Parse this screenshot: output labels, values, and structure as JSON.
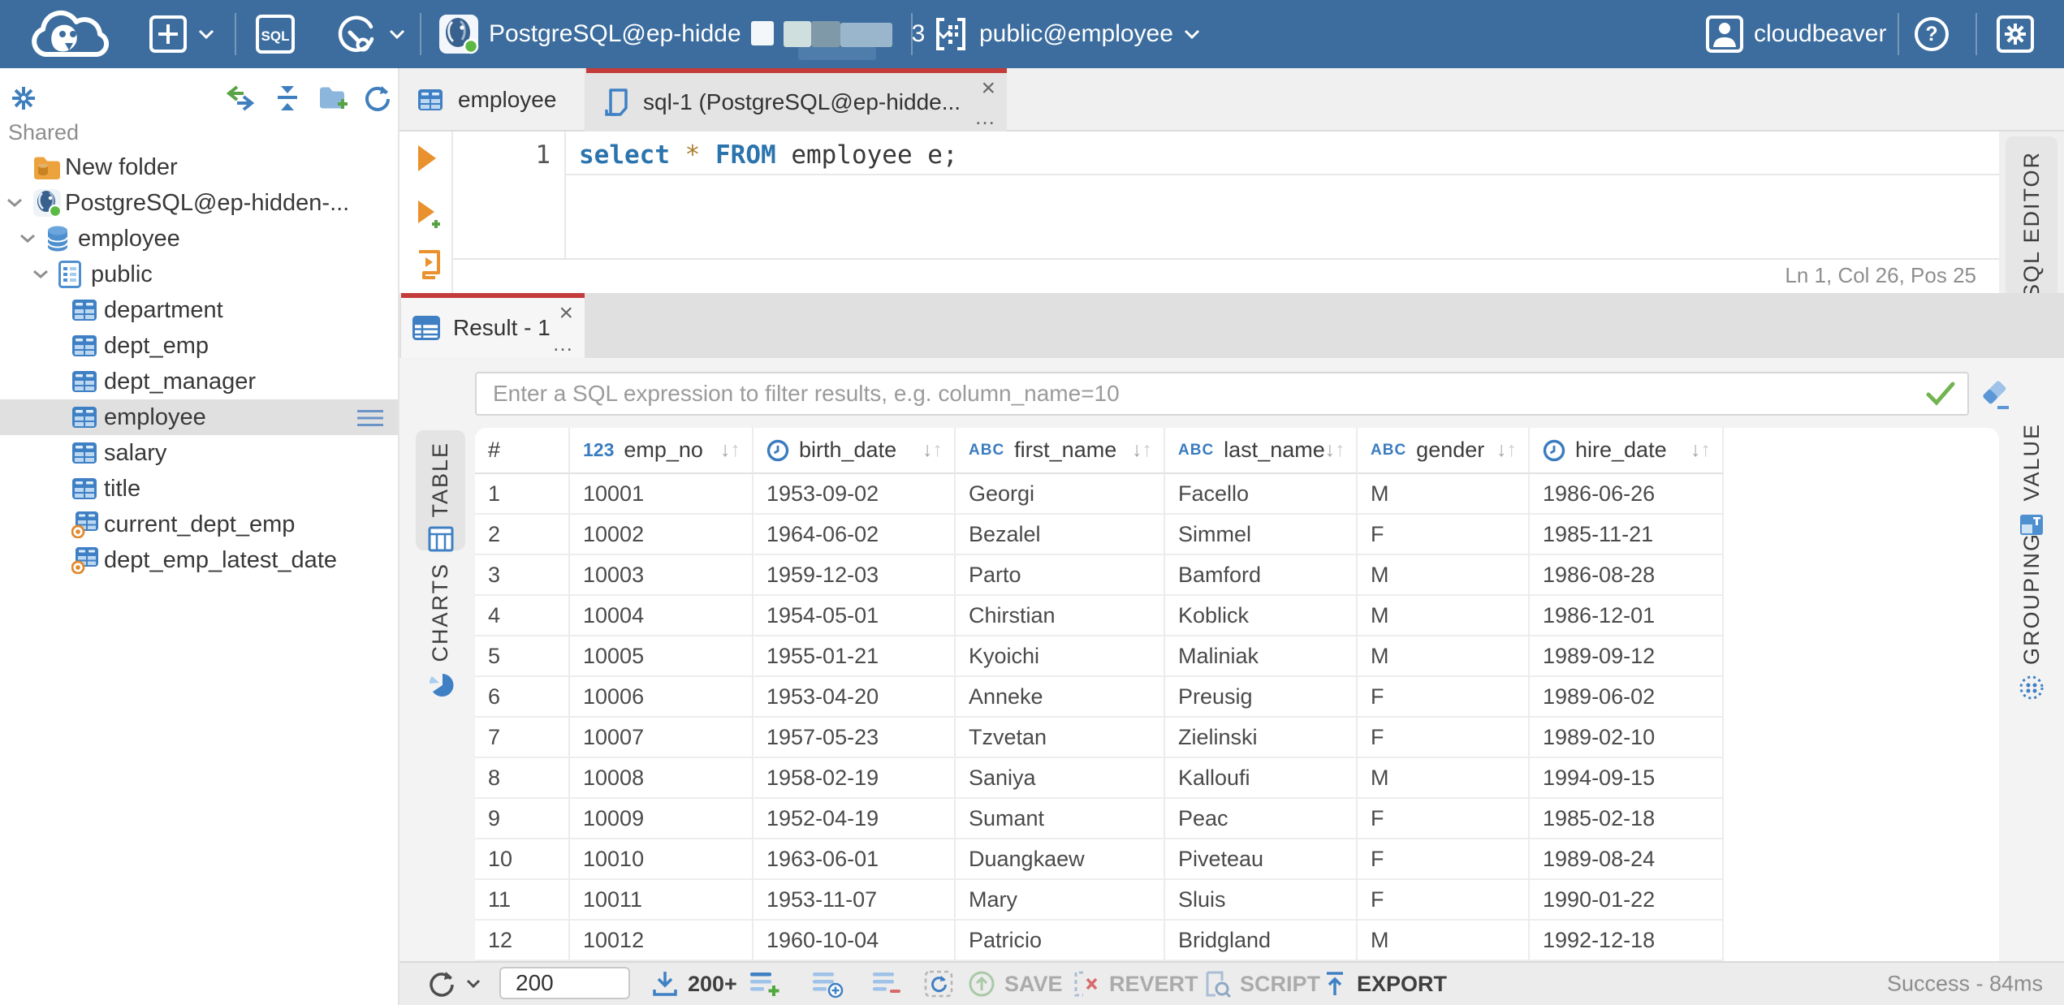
{
  "colors": {
    "topbar_blue": "#3c6d9e",
    "accent_red": "#c43b3b",
    "accent_blue": "#3f80c4",
    "success_green": "#72b352",
    "icon_orange": "#e8912d"
  },
  "topbar": {
    "buttons": {
      "sql_badge": "SQL"
    },
    "connection": {
      "label": "PostgreSQL@ep-hidde",
      "redacted_suffix": "3"
    },
    "schema_selector": "public@employee",
    "user": "cloudbeaver"
  },
  "sidebar": {
    "section": "Shared",
    "tree": [
      {
        "label": "New folder",
        "icon": "folder-database",
        "indent": 0,
        "chevron": false,
        "selected": false
      },
      {
        "label": "PostgreSQL@ep-hidden-...",
        "icon": "postgres",
        "indent": 0,
        "chevron": true,
        "selected": false
      },
      {
        "label": "employee",
        "icon": "database",
        "indent": 1,
        "chevron": true,
        "selected": false
      },
      {
        "label": "public",
        "icon": "schema",
        "indent": 2,
        "chevron": true,
        "selected": false
      },
      {
        "label": "department",
        "icon": "table",
        "indent": 3,
        "chevron": false,
        "selected": false
      },
      {
        "label": "dept_emp",
        "icon": "table",
        "indent": 3,
        "chevron": false,
        "selected": false
      },
      {
        "label": "dept_manager",
        "icon": "table",
        "indent": 3,
        "chevron": false,
        "selected": false
      },
      {
        "label": "employee",
        "icon": "table",
        "indent": 3,
        "chevron": false,
        "selected": true
      },
      {
        "label": "salary",
        "icon": "table",
        "indent": 3,
        "chevron": false,
        "selected": false
      },
      {
        "label": "title",
        "icon": "table",
        "indent": 3,
        "chevron": false,
        "selected": false
      },
      {
        "label": "current_dept_emp",
        "icon": "view",
        "indent": 3,
        "chevron": false,
        "selected": false
      },
      {
        "label": "dept_emp_latest_date",
        "icon": "view",
        "indent": 3,
        "chevron": false,
        "selected": false
      }
    ]
  },
  "editor_tabs": [
    {
      "label": "employee",
      "icon": "table"
    },
    {
      "label": "sql-1 (PostgreSQL@ep-hidde...",
      "icon": "sql-script"
    }
  ],
  "editor": {
    "line_number": "1",
    "tokens": [
      {
        "text": "select",
        "type": "keyword"
      },
      {
        "text": " ",
        "type": "plain"
      },
      {
        "text": "*",
        "type": "operator"
      },
      {
        "text": " ",
        "type": "plain"
      },
      {
        "text": "FROM",
        "type": "keyword"
      },
      {
        "text": " employee e;",
        "type": "plain"
      }
    ],
    "status": "Ln 1, Col 26, Pos 25",
    "panel_tab": "SQL EDITOR"
  },
  "result": {
    "tab": "Result - 1",
    "filter_placeholder": "Enter a SQL expression to filter results, e.g. column_name=10",
    "view_tabs": [
      {
        "label": "TABLE",
        "active": true
      },
      {
        "label": "CHARTS",
        "active": false
      }
    ],
    "side_tabs": [
      {
        "label": "VALUE"
      },
      {
        "label": "GROUPING"
      }
    ]
  },
  "grid": {
    "columns": [
      {
        "label": "#",
        "type": "rownum"
      },
      {
        "label": "emp_no",
        "type": "number"
      },
      {
        "label": "birth_date",
        "type": "datetime"
      },
      {
        "label": "first_name",
        "type": "string"
      },
      {
        "label": "last_name",
        "type": "string"
      },
      {
        "label": "gender",
        "type": "string"
      },
      {
        "label": "hire_date",
        "type": "datetime"
      }
    ],
    "rows": [
      [
        "1",
        "10001",
        "1953-09-02",
        "Georgi",
        "Facello",
        "M",
        "1986-06-26"
      ],
      [
        "2",
        "10002",
        "1964-06-02",
        "Bezalel",
        "Simmel",
        "F",
        "1985-11-21"
      ],
      [
        "3",
        "10003",
        "1959-12-03",
        "Parto",
        "Bamford",
        "M",
        "1986-08-28"
      ],
      [
        "4",
        "10004",
        "1954-05-01",
        "Chirstian",
        "Koblick",
        "M",
        "1986-12-01"
      ],
      [
        "5",
        "10005",
        "1955-01-21",
        "Kyoichi",
        "Maliniak",
        "M",
        "1989-09-12"
      ],
      [
        "6",
        "10006",
        "1953-04-20",
        "Anneke",
        "Preusig",
        "F",
        "1989-06-02"
      ],
      [
        "7",
        "10007",
        "1957-05-23",
        "Tzvetan",
        "Zielinski",
        "F",
        "1989-02-10"
      ],
      [
        "8",
        "10008",
        "1958-02-19",
        "Saniya",
        "Kalloufi",
        "M",
        "1994-09-15"
      ],
      [
        "9",
        "10009",
        "1952-04-19",
        "Sumant",
        "Peac",
        "F",
        "1985-02-18"
      ],
      [
        "10",
        "10010",
        "1963-06-01",
        "Duangkaew",
        "Piveteau",
        "F",
        "1989-08-24"
      ],
      [
        "11",
        "10011",
        "1953-11-07",
        "Mary",
        "Sluis",
        "F",
        "1990-01-22"
      ],
      [
        "12",
        "10012",
        "1960-10-04",
        "Patricio",
        "Bridgland",
        "M",
        "1992-12-18"
      ]
    ]
  },
  "toolbar": {
    "row_limit": "200",
    "fetch_more": "200+",
    "save": "SAVE",
    "revert": "REVERT",
    "script": "SCRIPT",
    "export": "EXPORT",
    "status": "Success - 84ms"
  }
}
